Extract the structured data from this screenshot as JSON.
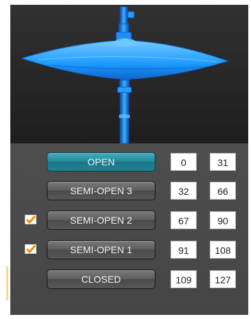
{
  "rows": [
    {
      "label": "OPEN",
      "min": "0",
      "max": "31",
      "active": true,
      "checked": false
    },
    {
      "label": "SEMI-OPEN 3",
      "min": "32",
      "max": "66",
      "active": false,
      "checked": false
    },
    {
      "label": "SEMI-OPEN 2",
      "min": "67",
      "max": "90",
      "active": false,
      "checked": true
    },
    {
      "label": "SEMI-OPEN 1",
      "min": "91",
      "max": "108",
      "active": false,
      "checked": true
    },
    {
      "label": "CLOSED",
      "min": "109",
      "max": "127",
      "active": false,
      "checked": false
    }
  ],
  "colors": {
    "accent": "#23899a",
    "cymbal": "#1e9bff",
    "checkmark": "#f28c00"
  },
  "icons": {
    "viewport": "hi-hat-cymbal-icon",
    "checkbox": "checkmark-icon"
  }
}
